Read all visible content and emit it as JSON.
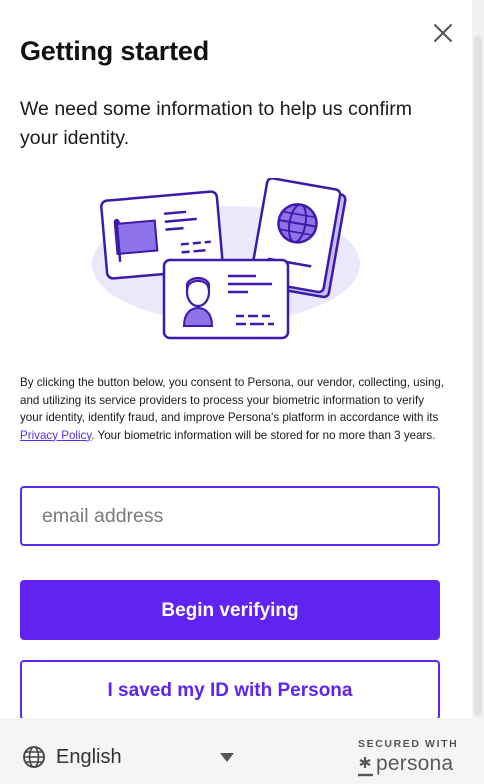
{
  "header": {
    "title": "Getting started",
    "close_icon": "close-icon"
  },
  "subtitle": "We need some information to help us confirm your identity.",
  "illustration": {
    "name": "id-documents-illustration",
    "accent_color": "#4a1db8",
    "fill_color": "#ece8fb"
  },
  "consent": {
    "text_before": "By clicking the button below, you consent to Persona, our vendor, collecting, using, and utilizing its service providers to process your biometric information to verify your identity, identify fraud, and improve Persona's platform in accordance with its ",
    "link_label": "Privacy Policy",
    "text_after": ". Your biometric information will be stored for no more than 3 years."
  },
  "email": {
    "placeholder": "email address",
    "value": ""
  },
  "buttons": {
    "primary_label": "Begin verifying",
    "secondary_label": "I saved my ID with Persona"
  },
  "footer": {
    "language": "English",
    "globe_icon": "globe-icon",
    "secured_label": "SECURED WITH",
    "brand": "persona"
  },
  "colors": {
    "accent": "#6123f2",
    "footer_bg": "#f5f5f5"
  }
}
